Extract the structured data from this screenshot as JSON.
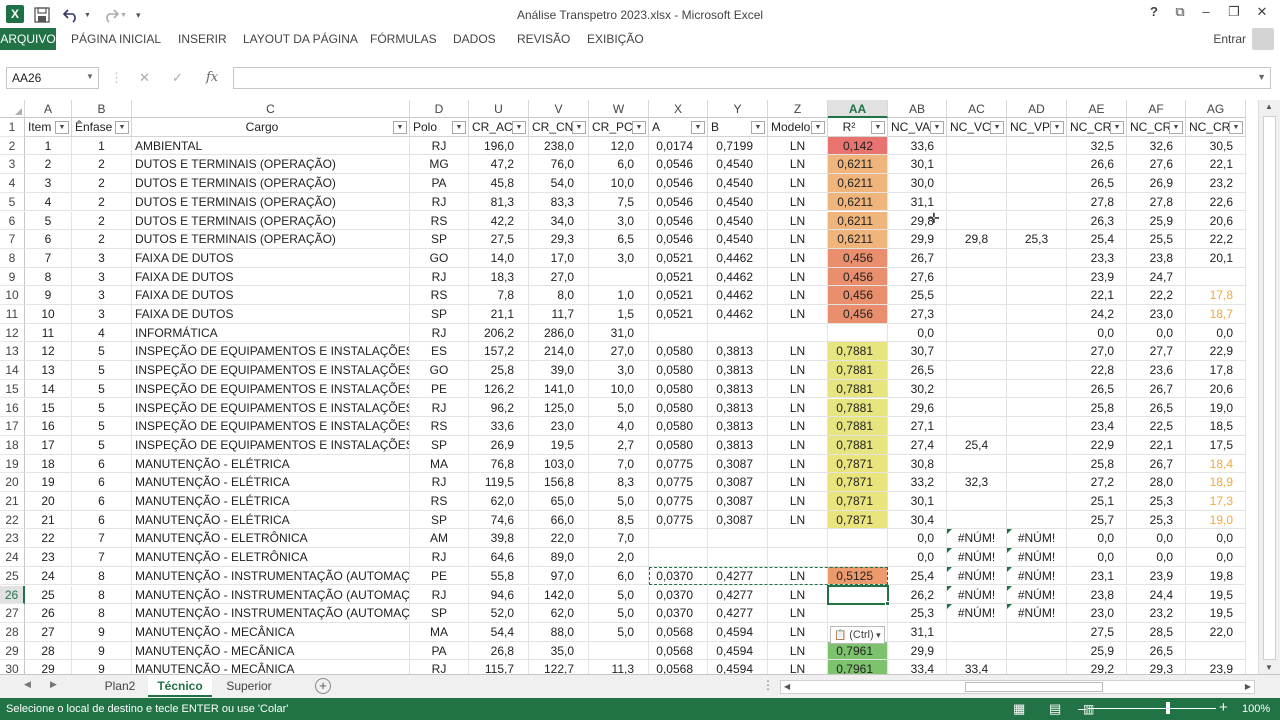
{
  "window": {
    "title": "Análise Transpetro 2023.xlsx - Microsoft Excel",
    "signin": "Entrar"
  },
  "qat": {
    "excel_icon": "X",
    "save_icon": "save-icon",
    "undo_icon": "undo-icon",
    "redo_icon": "redo-icon"
  },
  "ribbon": {
    "tabs": [
      "ARQUIVO",
      "PÁGINA INICIAL",
      "INSERIR",
      "LAYOUT DA PÁGINA",
      "FÓRMULAS",
      "DADOS",
      "REVISÃO",
      "EXIBIÇÃO"
    ]
  },
  "formula_bar": {
    "name_box": "AA26",
    "fx": "fx",
    "formula": ""
  },
  "columns": [
    "A",
    "B",
    "C",
    "D",
    "U",
    "V",
    "W",
    "X",
    "Y",
    "Z",
    "AA",
    "AB",
    "AC",
    "AD",
    "AE",
    "AF",
    "AG"
  ],
  "selected_column": "AA",
  "header_row": [
    "Item",
    "Ênfase",
    "Cargo",
    "Polo",
    "CR_AC",
    "CR_CN",
    "CR_PCD",
    "A",
    "B",
    "Modelo",
    "R²",
    "NC_VA",
    "NC_VC",
    "NC_VPC",
    "NC_CR",
    "NC_CRC",
    "NC_CRP"
  ],
  "rows": [
    {
      "n": "2",
      "v": [
        "1",
        "1",
        "AMBIENTAL",
        "RJ",
        "196,0",
        "238,0",
        "12,0",
        "0,0174",
        "0,7199",
        "LN",
        "0,142",
        "33,6",
        "",
        "",
        "32,5",
        "32,6",
        "30,5"
      ]
    },
    {
      "n": "3",
      "v": [
        "2",
        "2",
        "DUTOS E TERMINAIS (OPERAÇÃO)",
        "MG",
        "47,2",
        "76,0",
        "6,0",
        "0,0546",
        "0,4540",
        "LN",
        "0,6211",
        "30,1",
        "",
        "",
        "26,6",
        "27,6",
        "22,1"
      ]
    },
    {
      "n": "4",
      "v": [
        "3",
        "2",
        "DUTOS E TERMINAIS (OPERAÇÃO)",
        "PA",
        "45,8",
        "54,0",
        "10,0",
        "0,0546",
        "0,4540",
        "LN",
        "0,6211",
        "30,0",
        "",
        "",
        "26,5",
        "26,9",
        "23,2"
      ]
    },
    {
      "n": "5",
      "v": [
        "4",
        "2",
        "DUTOS E TERMINAIS (OPERAÇÃO)",
        "RJ",
        "81,3",
        "83,3",
        "7,5",
        "0,0546",
        "0,4540",
        "LN",
        "0,6211",
        "31,1",
        "",
        "",
        "27,8",
        "27,8",
        "22,6"
      ]
    },
    {
      "n": "6",
      "v": [
        "5",
        "2",
        "DUTOS E TERMINAIS (OPERAÇÃO)",
        "RS",
        "42,2",
        "34,0",
        "3,0",
        "0,0546",
        "0,4540",
        "LN",
        "0,6211",
        "29,8",
        "",
        "",
        "26,3",
        "25,9",
        "20,6"
      ]
    },
    {
      "n": "7",
      "v": [
        "6",
        "2",
        "DUTOS E TERMINAIS (OPERAÇÃO)",
        "SP",
        "27,5",
        "29,3",
        "6,5",
        "0,0546",
        "0,4540",
        "LN",
        "0,6211",
        "29,9",
        "29,8",
        "25,3",
        "25,4",
        "25,5",
        "22,2"
      ]
    },
    {
      "n": "8",
      "v": [
        "7",
        "3",
        "FAIXA DE DUTOS",
        "GO",
        "14,0",
        "17,0",
        "3,0",
        "0,0521",
        "0,4462",
        "LN",
        "0,456",
        "26,7",
        "",
        "",
        "23,3",
        "23,8",
        "20,1"
      ]
    },
    {
      "n": "9",
      "v": [
        "8",
        "3",
        "FAIXA DE DUTOS",
        "RJ",
        "18,3",
        "27,0",
        "",
        "0,0521",
        "0,4462",
        "LN",
        "0,456",
        "27,6",
        "",
        "",
        "23,9",
        "24,7",
        ""
      ]
    },
    {
      "n": "10",
      "v": [
        "9",
        "3",
        "FAIXA DE DUTOS",
        "RS",
        "7,8",
        "8,0",
        "1,0",
        "0,0521",
        "0,4462",
        "LN",
        "0,456",
        "25,5",
        "",
        "",
        "22,1",
        "22,2",
        "17,8"
      ]
    },
    {
      "n": "11",
      "v": [
        "10",
        "3",
        "FAIXA DE DUTOS",
        "SP",
        "21,1",
        "11,7",
        "1,5",
        "0,0521",
        "0,4462",
        "LN",
        "0,456",
        "27,3",
        "",
        "",
        "24,2",
        "23,0",
        "18,7"
      ]
    },
    {
      "n": "12",
      "v": [
        "11",
        "4",
        "INFORMÁTICA",
        "RJ",
        "206,2",
        "286,0",
        "31,0",
        "",
        "",
        "",
        "",
        "0,0",
        "",
        "",
        "0,0",
        "0,0",
        "0,0"
      ]
    },
    {
      "n": "13",
      "v": [
        "12",
        "5",
        "INSPEÇÃO DE EQUIPAMENTOS E INSTALAÇÕES",
        "ES",
        "157,2",
        "214,0",
        "27,0",
        "0,0580",
        "0,3813",
        "LN",
        "0,7881",
        "30,7",
        "",
        "",
        "27,0",
        "27,7",
        "22,9"
      ]
    },
    {
      "n": "14",
      "v": [
        "13",
        "5",
        "INSPEÇÃO DE EQUIPAMENTOS E INSTALAÇÕES",
        "GO",
        "25,8",
        "39,0",
        "3,0",
        "0,0580",
        "0,3813",
        "LN",
        "0,7881",
        "26,5",
        "",
        "",
        "22,8",
        "23,6",
        "17,8"
      ]
    },
    {
      "n": "15",
      "v": [
        "14",
        "5",
        "INSPEÇÃO DE EQUIPAMENTOS E INSTALAÇÕES",
        "PE",
        "126,2",
        "141,0",
        "10,0",
        "0,0580",
        "0,3813",
        "LN",
        "0,7881",
        "30,2",
        "",
        "",
        "26,5",
        "26,7",
        "20,6"
      ]
    },
    {
      "n": "16",
      "v": [
        "15",
        "5",
        "INSPEÇÃO DE EQUIPAMENTOS E INSTALAÇÕES",
        "RJ",
        "96,2",
        "125,0",
        "5,0",
        "0,0580",
        "0,3813",
        "LN",
        "0,7881",
        "29,6",
        "",
        "",
        "25,8",
        "26,5",
        "19,0"
      ]
    },
    {
      "n": "17",
      "v": [
        "16",
        "5",
        "INSPEÇÃO DE EQUIPAMENTOS E INSTALAÇÕES",
        "RS",
        "33,6",
        "23,0",
        "4,0",
        "0,0580",
        "0,3813",
        "LN",
        "0,7881",
        "27,1",
        "",
        "",
        "23,4",
        "22,5",
        "18,5"
      ]
    },
    {
      "n": "18",
      "v": [
        "17",
        "5",
        "INSPEÇÃO DE EQUIPAMENTOS E INSTALAÇÕES",
        "SP",
        "26,9",
        "19,5",
        "2,7",
        "0,0580",
        "0,3813",
        "LN",
        "0,7881",
        "27,4",
        "25,4",
        "",
        "22,9",
        "22,1",
        "17,5"
      ]
    },
    {
      "n": "19",
      "v": [
        "18",
        "6",
        "MANUTENÇÃO - ELÉTRICA",
        "MA",
        "76,8",
        "103,0",
        "7,0",
        "0,0775",
        "0,3087",
        "LN",
        "0,7871",
        "30,8",
        "",
        "",
        "25,8",
        "26,7",
        "18,4"
      ]
    },
    {
      "n": "20",
      "v": [
        "19",
        "6",
        "MANUTENÇÃO - ELÉTRICA",
        "RJ",
        "119,5",
        "156,8",
        "8,3",
        "0,0775",
        "0,3087",
        "LN",
        "0,7871",
        "33,2",
        "32,3",
        "",
        "27,2",
        "28,0",
        "18,9"
      ]
    },
    {
      "n": "21",
      "v": [
        "20",
        "6",
        "MANUTENÇÃO - ELÉTRICA",
        "RS",
        "62,0",
        "65,0",
        "5,0",
        "0,0775",
        "0,3087",
        "LN",
        "0,7871",
        "30,1",
        "",
        "",
        "25,1",
        "25,3",
        "17,3"
      ]
    },
    {
      "n": "22",
      "v": [
        "21",
        "6",
        "MANUTENÇÃO - ELÉTRICA",
        "SP",
        "74,6",
        "66,0",
        "8,5",
        "0,0775",
        "0,3087",
        "LN",
        "0,7871",
        "30,4",
        "",
        "",
        "25,7",
        "25,3",
        "19,0"
      ]
    },
    {
      "n": "23",
      "v": [
        "22",
        "7",
        "MANUTENÇÃO - ELETRÔNICA",
        "AM",
        "39,8",
        "22,0",
        "7,0",
        "",
        "",
        "",
        "",
        "0,0",
        "#NÚM!",
        "#NÚM!",
        "0,0",
        "0,0",
        "0,0"
      ]
    },
    {
      "n": "24",
      "v": [
        "23",
        "7",
        "MANUTENÇÃO - ELETRÔNICA",
        "RJ",
        "64,6",
        "89,0",
        "2,0",
        "",
        "",
        "",
        "",
        "0,0",
        "#NÚM!",
        "#NÚM!",
        "0,0",
        "0,0",
        "0,0"
      ]
    },
    {
      "n": "25",
      "v": [
        "24",
        "8",
        "MANUTENÇÃO - INSTRUMENTAÇÃO (AUTOMAÇÃO)",
        "PE",
        "55,8",
        "97,0",
        "6,0",
        "0,0370",
        "0,4277",
        "LN",
        "0,5125",
        "25,4",
        "#NÚM!",
        "#NÚM!",
        "23,1",
        "23,9",
        "19,8"
      ]
    },
    {
      "n": "26",
      "v": [
        "25",
        "8",
        "MANUTENÇÃO - INSTRUMENTAÇÃO (AUTOMAÇÃO)",
        "RJ",
        "94,6",
        "142,0",
        "5,0",
        "0,0370",
        "0,4277",
        "LN",
        "",
        "26,2",
        "#NÚM!",
        "#NÚM!",
        "23,8",
        "24,4",
        "19,5"
      ]
    },
    {
      "n": "27",
      "v": [
        "26",
        "8",
        "MANUTENÇÃO - INSTRUMENTAÇÃO (AUTOMAÇÃO)",
        "SP",
        "52,0",
        "62,0",
        "5,0",
        "0,0370",
        "0,4277",
        "LN",
        "",
        "25,3",
        "#NÚM!",
        "#NÚM!",
        "23,0",
        "23,2",
        "19,5"
      ]
    },
    {
      "n": "28",
      "v": [
        "27",
        "9",
        "MANUTENÇÃO - MECÂNICA",
        "MA",
        "54,4",
        "88,0",
        "5,0",
        "0,0568",
        "0,4594",
        "LN",
        "",
        "31,1",
        "",
        "",
        "27,5",
        "28,5",
        "22,0"
      ]
    },
    {
      "n": "29",
      "v": [
        "28",
        "9",
        "MANUTENÇÃO - MECÂNICA",
        "PA",
        "26,8",
        "35,0",
        "",
        "0,0568",
        "0,4594",
        "LN",
        "0,7961",
        "29,9",
        "",
        "",
        "25,9",
        "26,5",
        ""
      ]
    },
    {
      "n": "30",
      "v": [
        "29",
        "9",
        "MANUTENÇÃO - MECÂNICA",
        "RJ",
        "115,7",
        "122,7",
        "11,3",
        "0,0568",
        "0,4594",
        "LN",
        "0,7961",
        "33,4",
        "33,4",
        "",
        "29,2",
        "29,3",
        "23,9"
      ]
    }
  ],
  "r2_fill": {
    "0,142": "#e8736f",
    "0,6211": "#f0b57c",
    "0,456": "#ea8f6d",
    "0,7881": "#e6e57f",
    "0,7871": "#eae47d",
    "0,5125": "#ec9a6b",
    "0,7961": "#7dc36e"
  },
  "orange_text_color": "#f2a93a",
  "orange_ag_rows": [
    "10",
    "11",
    "19",
    "20",
    "21",
    "22"
  ],
  "paste_options": "(Ctrl)",
  "sheets": [
    "Plan2",
    "Técnico",
    "Superior"
  ],
  "active_sheet": "Técnico",
  "status": {
    "message": "Selecione o local de destino e tecle ENTER ou use 'Colar'",
    "zoom": "100%"
  },
  "accent": "#217346"
}
